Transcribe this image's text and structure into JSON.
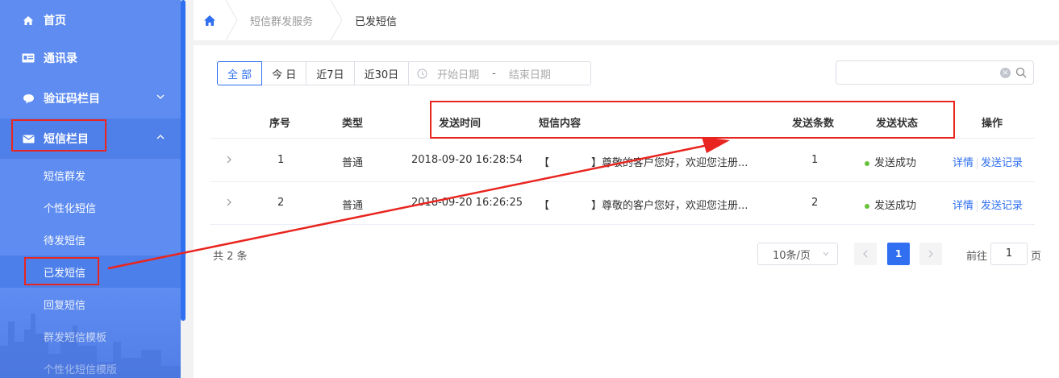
{
  "sidebar": {
    "items": [
      {
        "label": "首页",
        "icon": "home-icon"
      },
      {
        "label": "通讯录",
        "icon": "contacts-icon"
      },
      {
        "label": "验证码栏目",
        "icon": "chat-icon"
      },
      {
        "label": "短信栏目",
        "icon": "mail-icon"
      }
    ],
    "sub_items": [
      "短信群发",
      "个性化短信",
      "待发短信",
      "已发短信",
      "回复短信",
      "群发短信模板",
      "个性化短信模版"
    ]
  },
  "breadcrumb": {
    "items": [
      "短信群发服务",
      "已发短信"
    ]
  },
  "filters": {
    "buttons": [
      "全 部",
      "今 日",
      "近7日",
      "近30日"
    ],
    "start_placeholder": "开始日期",
    "range_sep": "-",
    "end_placeholder": "结束日期"
  },
  "search": {
    "value": ""
  },
  "table": {
    "headers": {
      "index": "序号",
      "type": "类型",
      "send_time": "发送时间",
      "content": "短信内容",
      "count": "发送条数",
      "status": "发送状态",
      "actions": "操作"
    },
    "rows": [
      {
        "index": "1",
        "type": "普通",
        "send_time": "2018-09-20 16:28:54",
        "content_prefix": "【",
        "content_suffix": "】尊敬的客户您好，欢迎您注册...",
        "count": "1",
        "status": "发送成功",
        "action_detail": "详情",
        "action_record": "发送记录"
      },
      {
        "index": "2",
        "type": "普通",
        "send_time": "2018-09-20 16:26:25",
        "content_prefix": "【",
        "content_suffix": "】尊敬的客户您好，欢迎您注册...",
        "count": "2",
        "status": "发送成功",
        "action_detail": "详情",
        "action_record": "发送记录"
      }
    ]
  },
  "pagination": {
    "total_text": "共 2 条",
    "page_size": "10条/页",
    "current_page": "1",
    "goto_label": "前往",
    "goto_value": "1",
    "page_unit": "页"
  },
  "colors": {
    "sidebar_bg": "#5e8cf1",
    "accent": "#2f6ff0",
    "success": "#67c23a",
    "annotation": "#e8251f"
  }
}
